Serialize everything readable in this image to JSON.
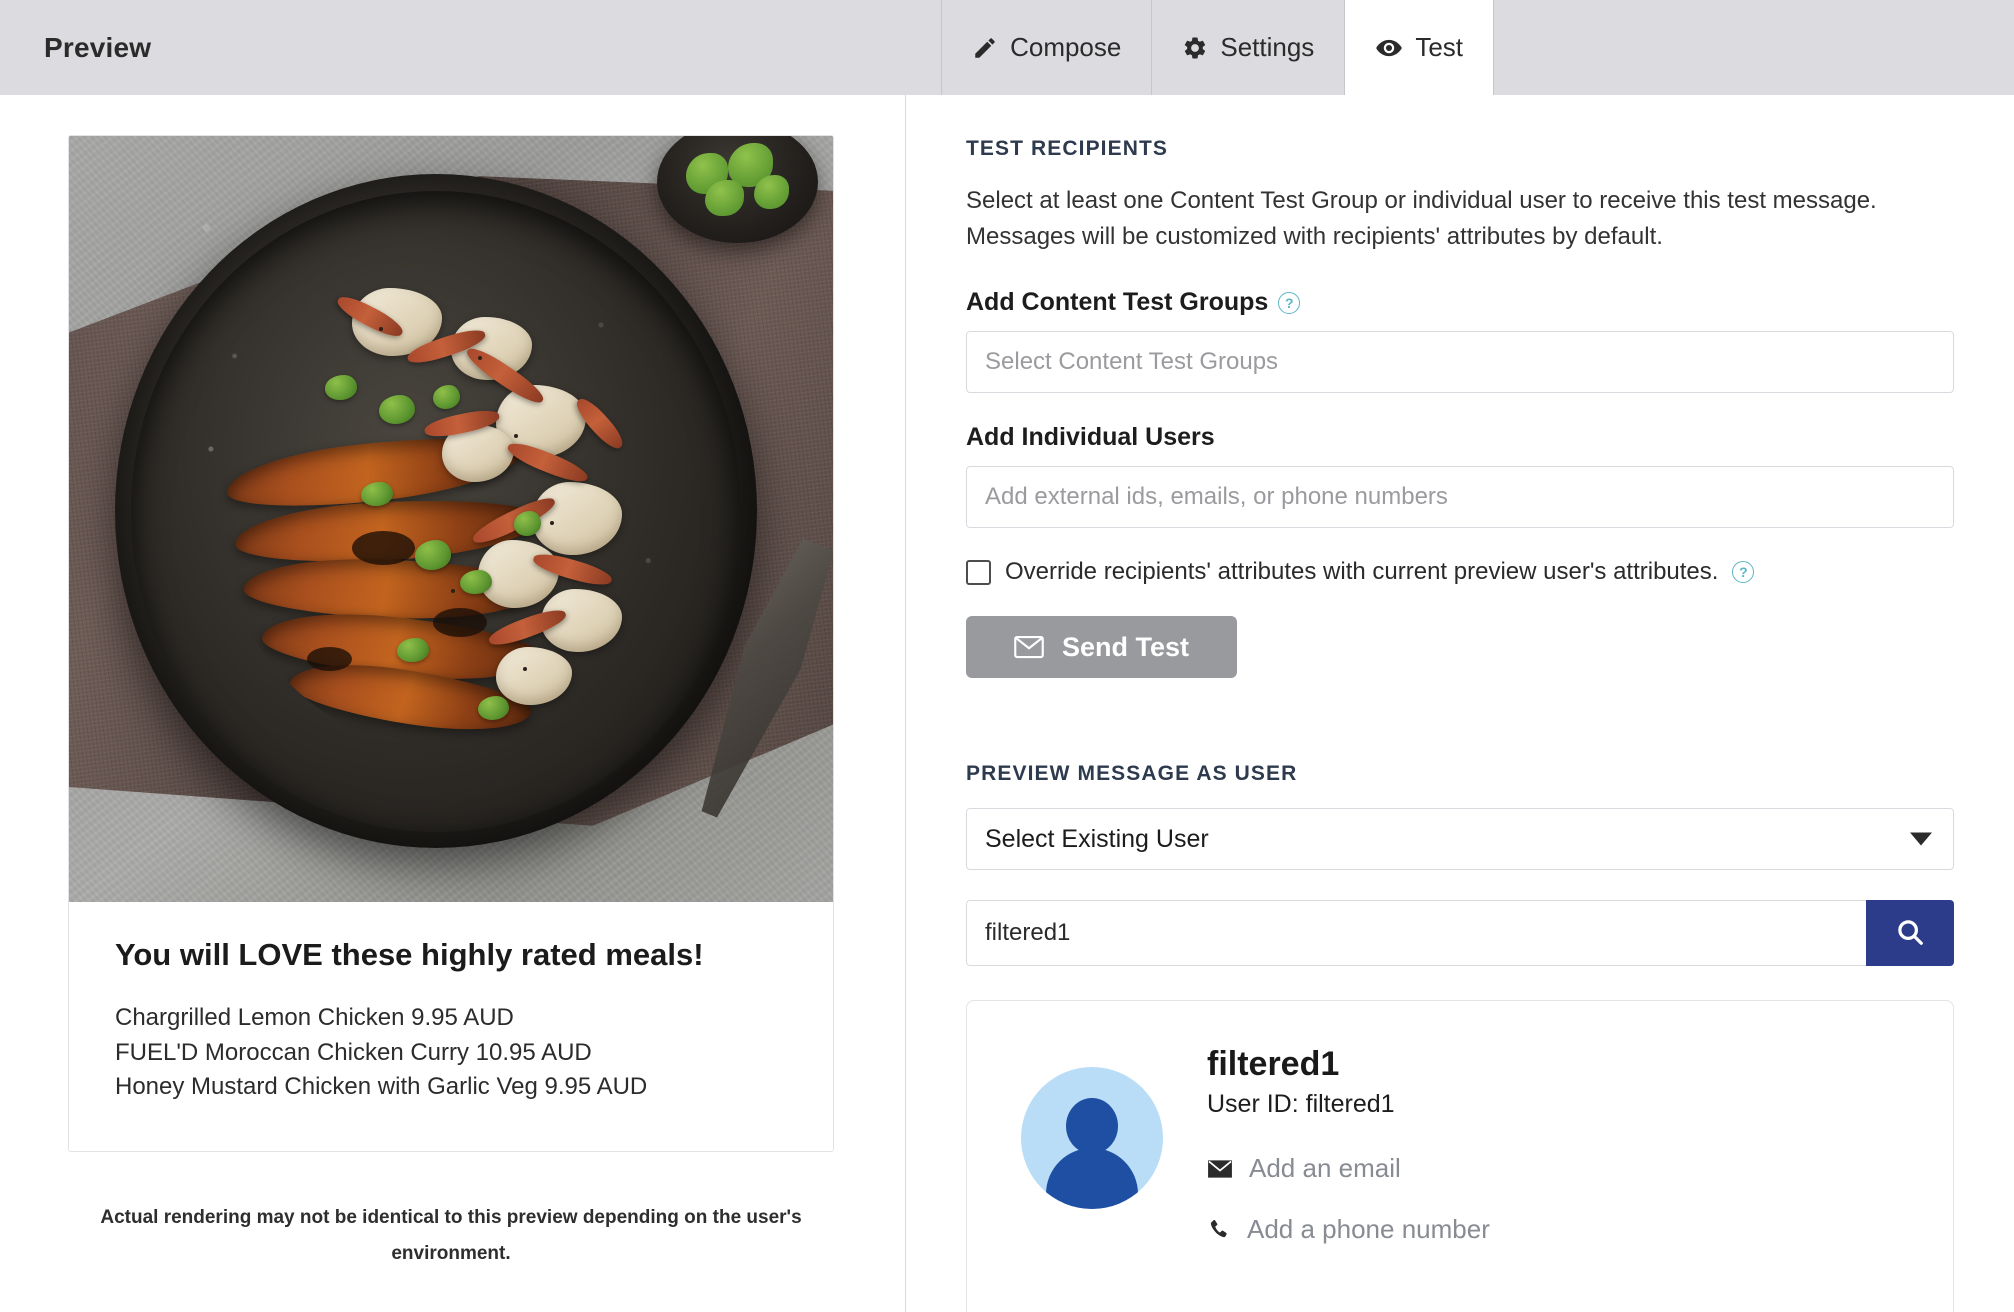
{
  "topbar": {
    "title": "Preview",
    "tabs": [
      {
        "label": "Compose",
        "icon": "pencil-icon",
        "active": false
      },
      {
        "label": "Settings",
        "icon": "gear-icon",
        "active": false
      },
      {
        "label": "Test",
        "icon": "eye-icon",
        "active": true
      }
    ]
  },
  "preview": {
    "image_alt": "Skillet of barbecue chargrilled chicken with bacon, feta and herbs on a grey stone surface",
    "title": "You will LOVE these highly rated meals!",
    "items": [
      "Chargrilled Lemon Chicken  9.95 AUD",
      "FUEL'D Moroccan Chicken Curry  10.95 AUD",
      "Honey Mustard Chicken with Garlic Veg  9.95 AUD"
    ],
    "disclaimer": "Actual rendering may not be identical to this preview depending on the user's environment."
  },
  "test_recipients": {
    "heading": "TEST RECIPIENTS",
    "description": "Select at least one Content Test Group or individual user to receive this test message. Messages will be customized with recipients' attributes by default.",
    "content_test_groups": {
      "label": "Add Content Test Groups",
      "help": "?",
      "value": "",
      "placeholder": "Select Content Test Groups"
    },
    "individual_users": {
      "label": "Add Individual Users",
      "value": "",
      "placeholder": "Add external ids, emails, or phone numbers"
    },
    "override_checkbox": {
      "label": "Override recipients' attributes with current preview user's attributes.",
      "checked": false,
      "help": "?"
    },
    "send_button": {
      "label": "Send Test",
      "icon": "envelope-icon",
      "enabled": false
    }
  },
  "preview_as_user": {
    "heading": "PREVIEW MESSAGE AS USER",
    "select": {
      "value": "Select Existing User",
      "caret": "chevron-down-icon"
    },
    "search": {
      "value": "filtered1",
      "placeholder": "",
      "button_icon": "search-icon"
    },
    "result": {
      "name": "filtered1",
      "user_id_label": "User ID: filtered1",
      "add_email": "Add an email",
      "add_phone": "Add a phone number",
      "avatar": "user-avatar-icon"
    }
  },
  "colors": {
    "topbar_bg": "#dcdce0",
    "accent_navy": "#2c3c8b",
    "heading_slate": "#2e3a4d",
    "help_teal": "#5bb6c4",
    "send_button_disabled": "#999a9e",
    "avatar_bg": "#b9ddf7",
    "avatar_fg": "#1e4fa3",
    "muted_text": "#888b92"
  }
}
